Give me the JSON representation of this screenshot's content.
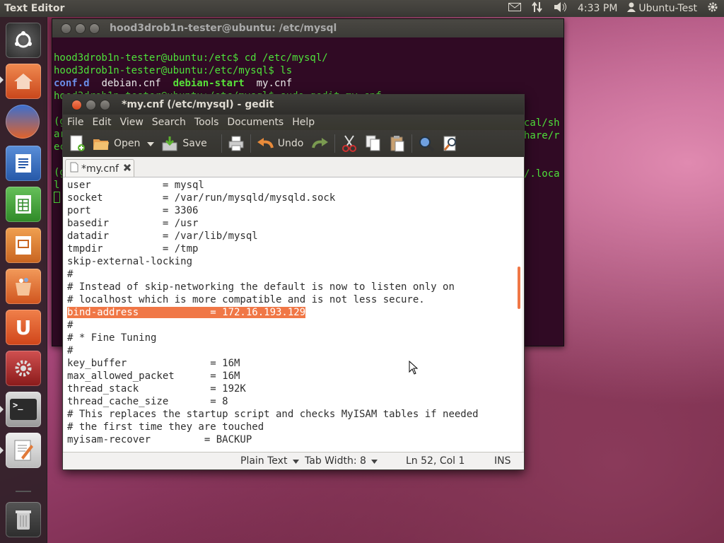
{
  "top_panel": {
    "app_title": "Text Editor",
    "time": "4:33 PM",
    "user": "Ubuntu-Test",
    "icons": [
      "mail-icon",
      "network-icon",
      "volume-icon",
      "user-icon",
      "gear-icon"
    ]
  },
  "launcher": {
    "items": [
      "ubuntu-dash",
      "home-folder",
      "firefox",
      "writer",
      "calc",
      "impress",
      "software-center",
      "ubuntu-one",
      "system-settings",
      "terminal",
      "text-editor",
      "trash"
    ]
  },
  "terminal": {
    "title": "hood3drob1n-tester@ubuntu: /etc/mysql",
    "lines": [
      "hood3drob1n-tester@ubuntu:/etc$ cd /etc/mysql/",
      "hood3drob1n-tester@ubuntu:/etc/mysql$ ls"
    ],
    "ls_items": [
      "conf.d",
      "debian.cnf",
      "debian-start",
      "my.cnf"
    ],
    "line3": "hood3drob1n-tester@ubuntu:/etc/mysql$ sudo gedit my.cnf",
    "partial_left": [
      "(g",
      "ar",
      "ec",
      "",
      "(g",
      "l"
    ],
    "partial_right": [
      "cal/sh",
      "hare/r",
      "",
      "",
      "/.loca"
    ]
  },
  "gedit": {
    "title": "*my.cnf (/etc/mysql) - gedit",
    "menu": [
      "File",
      "Edit",
      "View",
      "Search",
      "Tools",
      "Documents",
      "Help"
    ],
    "toolbar": {
      "open": "Open",
      "save": "Save",
      "undo": "Undo"
    },
    "tab_label": "*my.cnf",
    "code_lines": [
      "user            = mysql",
      "socket          = /var/run/mysqld/mysqld.sock",
      "port            = 3306",
      "basedir         = /usr",
      "datadir         = /var/lib/mysql",
      "tmpdir          = /tmp",
      "skip-external-locking",
      "#",
      "# Instead of skip-networking the default is now to listen only on",
      "# localhost which is more compatible and is not less secure.",
      "bind-address            = 172.16.193.129",
      "#",
      "# * Fine Tuning",
      "#",
      "key_buffer              = 16M",
      "max_allowed_packet      = 16M",
      "thread_stack            = 192K",
      "thread_cache_size       = 8",
      "# This replaces the startup script and checks MyISAM tables if needed",
      "# the first time they are touched",
      "myisam-recover         = BACKUP"
    ],
    "highlighted_line_index": 10,
    "status": {
      "language": "Plain Text",
      "tab_width": "Tab Width: 8",
      "position": "Ln 52, Col 1",
      "mode": "INS"
    }
  },
  "colors": {
    "accent": "#f07746",
    "terminal_bg": "#300a24",
    "terminal_text": "#4ee03a"
  }
}
